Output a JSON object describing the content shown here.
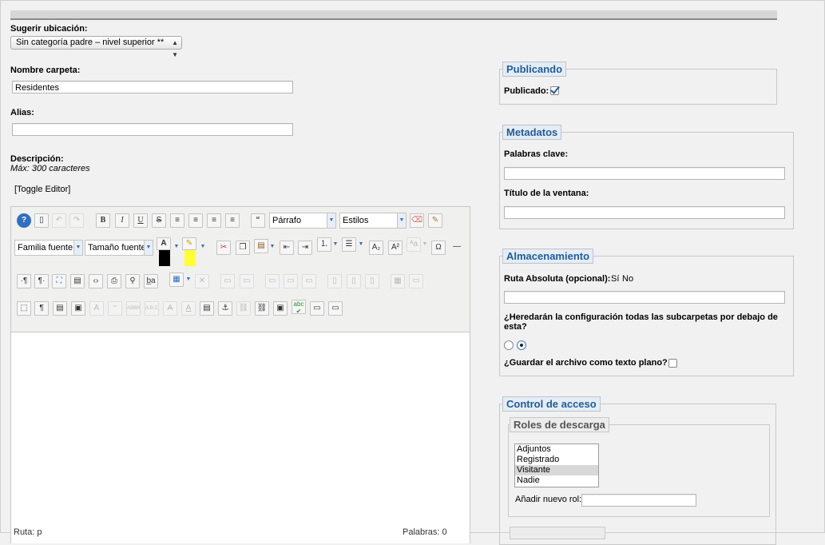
{
  "location": {
    "label": "Sugerir ubicación:",
    "selected": "Sin categoría padre – nivel superior **"
  },
  "folder_name": {
    "label": "Nombre carpeta:",
    "value": "Residentes"
  },
  "alias": {
    "label": "Alias:",
    "value": ""
  },
  "description": {
    "label": "Descripción:",
    "hint": "Máx: 300 caracteres",
    "toggle": "[Toggle Editor]"
  },
  "editor": {
    "format_select": "Párrafo",
    "styles_select": "Estilos",
    "font_family_select": "Familia fuente",
    "font_size_select": "Tamaño fuente",
    "status_path": "Ruta: p",
    "status_words": "Palabras: 0",
    "text_color": "#000000",
    "highlight_color": "#ffff33"
  },
  "publishing": {
    "legend": "Publicando",
    "published_label": "Publicado:",
    "published": true
  },
  "metadata": {
    "legend": "Metadatos",
    "keywords_label": "Palabras clave:",
    "keywords_value": "",
    "window_title_label": "Título de la ventana:",
    "window_title_value": ""
  },
  "storage": {
    "legend": "Almacenamiento",
    "absolute_path_label": "Ruta Absoluta (opcional):",
    "yes": "Sí",
    "no": "No",
    "absolute_path_value": "",
    "inherit_label": "¿Heredarán la configuración todas las subcarpetas por debajo de esta?",
    "plain_text_label": "¿Guardar el archivo como texto plano?",
    "plain_text_checked": false
  },
  "access": {
    "legend": "Control de acceso",
    "download_roles_legend": "Roles de descarga",
    "roles": [
      "Adjuntos",
      "Registrado",
      "Visitante",
      "Nadie"
    ],
    "selected_role": "Visitante",
    "add_role_label": "Añadir nuevo rol:",
    "add_role_value": ""
  },
  "colors": {
    "legend_text": "#1e5d9c",
    "legend_bg": "#e6ecf3",
    "page_bg": "#f1f1f1"
  }
}
